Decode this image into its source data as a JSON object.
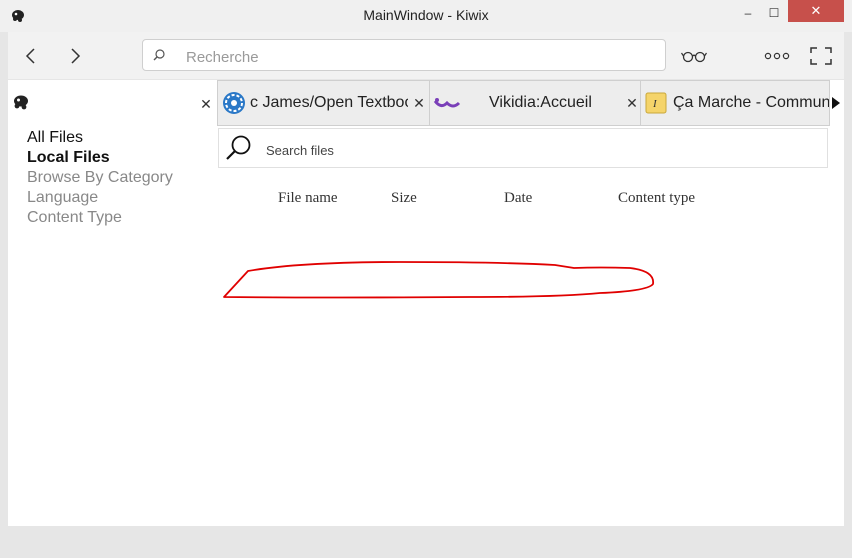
{
  "window": {
    "title": "MainWindow - Kiwix",
    "minimize": "–",
    "maximize": "☐",
    "close": "✕"
  },
  "toolbar": {
    "search_placeholder": "Recherche"
  },
  "tabs": [
    {
      "label": "c James/Open Textboo"
    },
    {
      "label": "Vikidia:Accueil"
    },
    {
      "label": "Ça Marche - Communa"
    }
  ],
  "library": {
    "filters": [
      {
        "label": "All Files"
      },
      {
        "label": "Local Files"
      },
      {
        "label": "Browse By Category"
      },
      {
        "label": "Language"
      },
      {
        "label": "Content Type"
      }
    ],
    "search_placeholder": "Search files",
    "columns": [
      "File name",
      "Size",
      "Date",
      "Content type"
    ]
  },
  "colors": {
    "close": "#c7504b",
    "annotation": "#e00000"
  }
}
